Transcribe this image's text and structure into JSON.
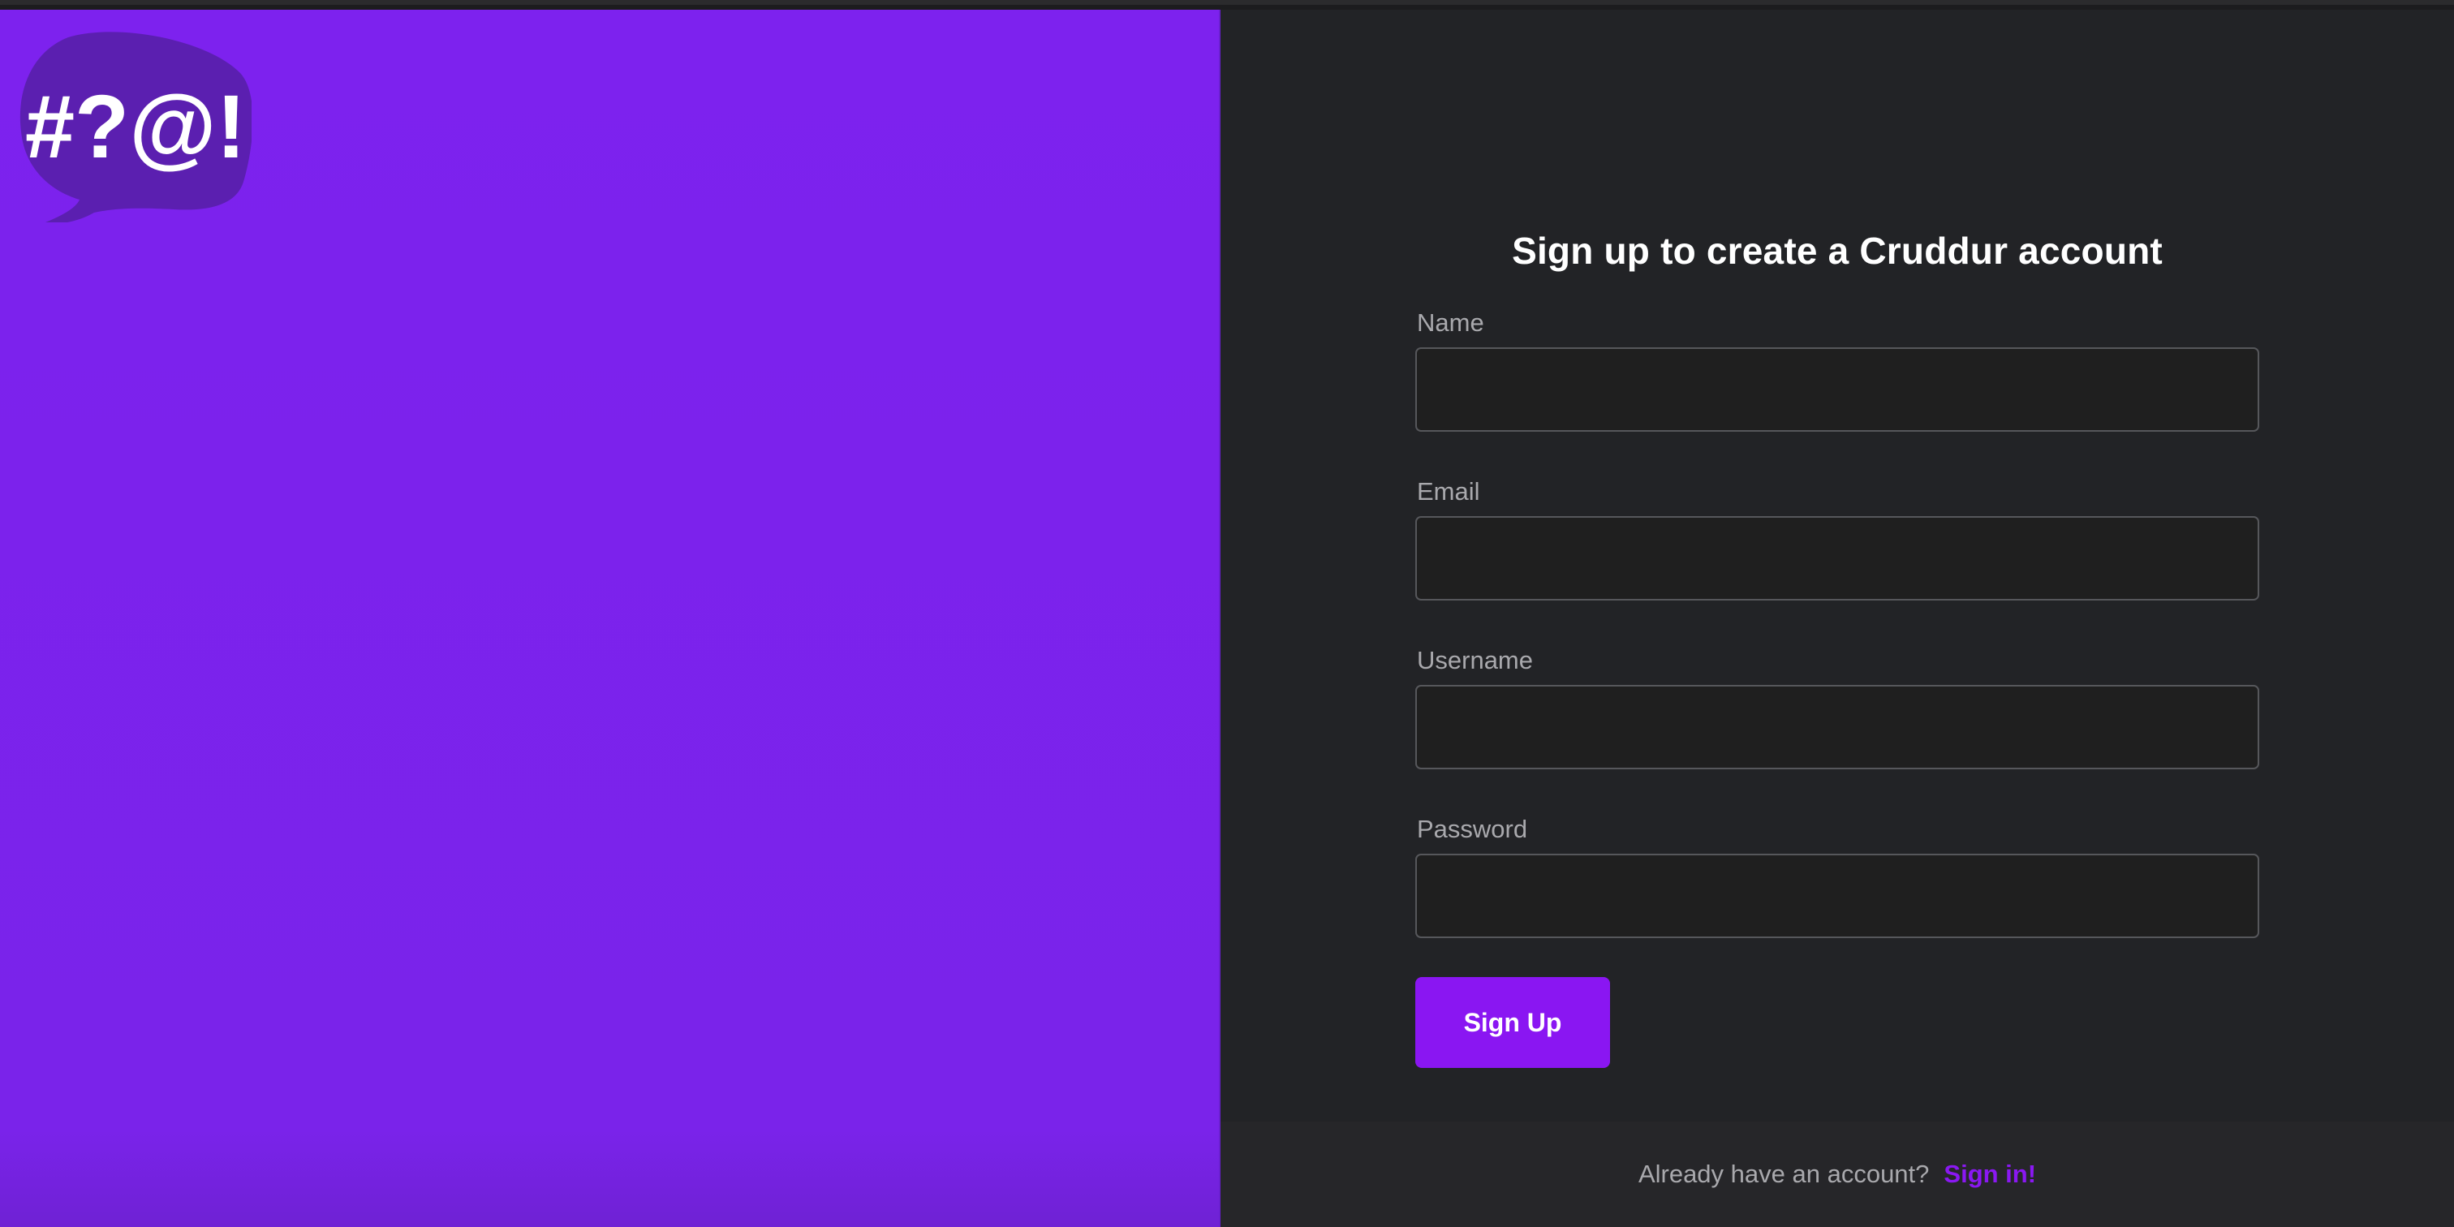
{
  "brand": {
    "logo_icon": "speech-bubble-logo",
    "logo_text": "#?@!",
    "accent_color": "#8a16f2",
    "panel_color": "#7d22ee"
  },
  "signup_form": {
    "title": "Sign up to create a Cruddur account",
    "fields": [
      {
        "label": "Name",
        "value": "",
        "placeholder": ""
      },
      {
        "label": "Email",
        "value": "",
        "placeholder": ""
      },
      {
        "label": "Username",
        "value": "",
        "placeholder": ""
      },
      {
        "label": "Password",
        "value": "",
        "placeholder": ""
      }
    ],
    "submit_label": "Sign Up"
  },
  "footer": {
    "prompt_text": "Already have an account?",
    "signin_link": "Sign in!"
  }
}
